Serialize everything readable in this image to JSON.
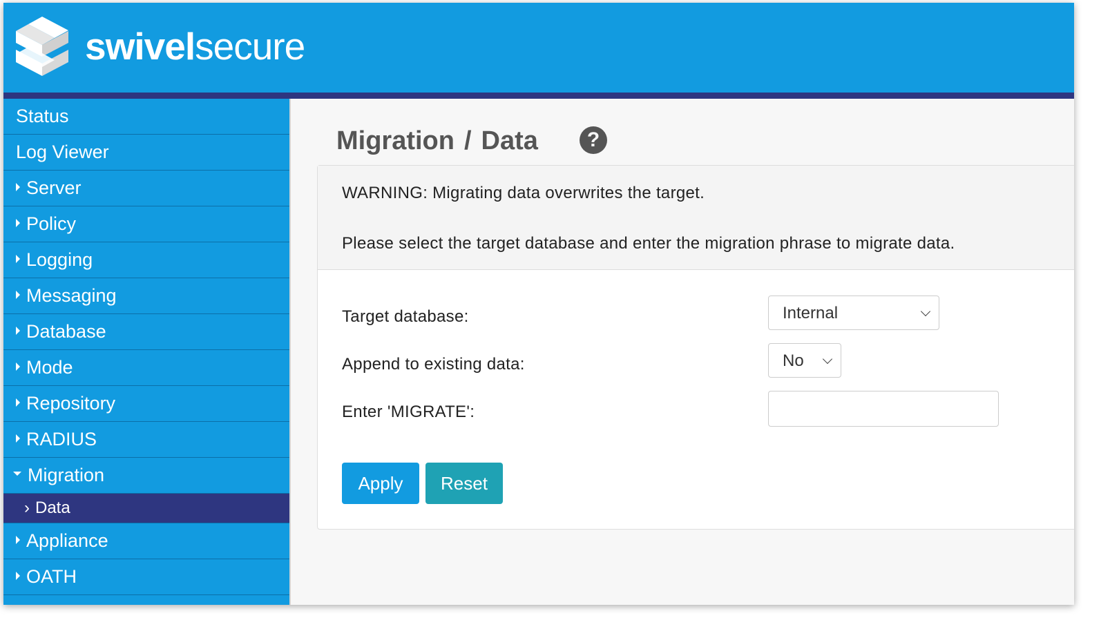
{
  "header": {
    "logo_bold": "swivel",
    "logo_light": "secure",
    "logo_icon": "swivel-cube-logo",
    "brand_color": "#129be0",
    "stripe_color": "#2e3680"
  },
  "sidebar": {
    "items": [
      {
        "label": "Status"
      },
      {
        "label": "Log Viewer"
      },
      {
        "label": "Server"
      },
      {
        "label": "Policy"
      },
      {
        "label": "Logging"
      },
      {
        "label": "Messaging"
      },
      {
        "label": "Database"
      },
      {
        "label": "Mode"
      },
      {
        "label": "Repository"
      },
      {
        "label": "RADIUS"
      },
      {
        "label": "Migration"
      },
      {
        "label": "Data"
      },
      {
        "label": "Appliance"
      },
      {
        "label": "OATH"
      }
    ]
  },
  "main": {
    "title_part1": "Migration",
    "title_sep": "/",
    "title_part2": "Data",
    "help_icon": "?",
    "warning": "WARNING: Migrating data overwrites the target.",
    "instructions": "Please select the target database and enter the migration phrase to migrate data.",
    "form": {
      "target_label": "Target database:",
      "target_value": "Internal",
      "append_label": "Append to existing data:",
      "append_value": "No",
      "migrate_label": "Enter 'MIGRATE':",
      "migrate_value": ""
    },
    "buttons": {
      "apply": "Apply",
      "reset": "Reset"
    }
  }
}
